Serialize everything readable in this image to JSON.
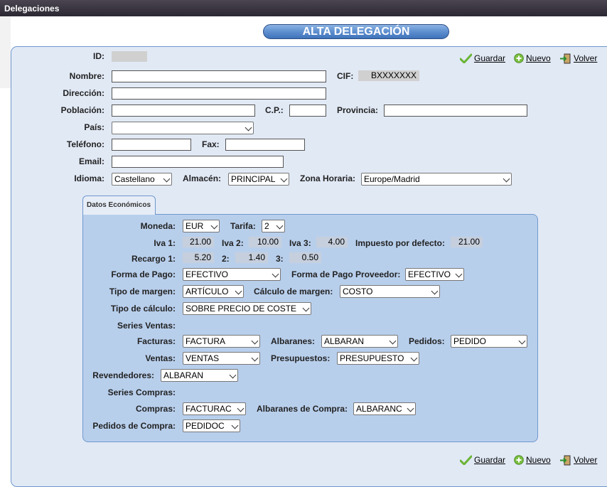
{
  "window": {
    "title": "Delegaciones"
  },
  "heading": "ALTA DELEGACIÓN",
  "actions": {
    "save": "Guardar",
    "new": "Nuevo",
    "back": "Volver"
  },
  "form": {
    "id": {
      "label": "ID:",
      "value": ""
    },
    "nombre": {
      "label": "Nombre:",
      "value": ""
    },
    "cif": {
      "label": "CIF:",
      "value": "BXXXXXXX"
    },
    "direccion": {
      "label": "Dirección:",
      "value": ""
    },
    "poblacion": {
      "label": "Población:",
      "value": ""
    },
    "cp": {
      "label": "C.P.:",
      "value": ""
    },
    "provincia": {
      "label": "Provincia:",
      "value": ""
    },
    "pais": {
      "label": "País:",
      "value": ""
    },
    "telefono": {
      "label": "Teléfono:",
      "value": ""
    },
    "fax": {
      "label": "Fax:",
      "value": ""
    },
    "email": {
      "label": "Email:",
      "value": ""
    },
    "idioma": {
      "label": "Idioma:",
      "value": "Castellano"
    },
    "almacen": {
      "label": "Almacén:",
      "value": "PRINCIPAL"
    },
    "zona": {
      "label": "Zona Horaria:",
      "value": "Europe/Madrid"
    }
  },
  "econ": {
    "tab": "Datos Económicos",
    "moneda": {
      "label": "Moneda:",
      "value": "EUR"
    },
    "tarifa": {
      "label": "Tarifa:",
      "value": "2"
    },
    "iva1": {
      "label": "Iva 1:",
      "value": "21.00"
    },
    "iva2": {
      "label": "Iva 2:",
      "value": "10.00"
    },
    "iva3": {
      "label": "Iva 3:",
      "value": "4.00"
    },
    "impuesto": {
      "label": "Impuesto por defecto:",
      "value": "21.00"
    },
    "recargo1": {
      "label": "Recargo 1:",
      "value": "5.20"
    },
    "recargo2": {
      "label": "2:",
      "value": "1.40"
    },
    "recargo3": {
      "label": "3:",
      "value": "0.50"
    },
    "formapago": {
      "label": "Forma de Pago:",
      "value": "EFECTIVO"
    },
    "formapagoprov": {
      "label": "Forma de Pago Proveedor:",
      "value": "EFECTIVO"
    },
    "tipomargen": {
      "label": "Tipo de margen:",
      "value": "ARTÍCULO"
    },
    "calculomargen": {
      "label": "Cálculo de margen:",
      "value": "COSTO"
    },
    "tipocalculo": {
      "label": "Tipo de cálculo:",
      "value": "SOBRE PRECIO DE COSTE"
    },
    "series_ventas": "Series Ventas:",
    "facturas": {
      "label": "Facturas:",
      "value": "FACTURA"
    },
    "albaranes": {
      "label": "Albaranes:",
      "value": "ALBARAN"
    },
    "pedidos": {
      "label": "Pedidos:",
      "value": "PEDIDO"
    },
    "ventas": {
      "label": "Ventas:",
      "value": "VENTAS"
    },
    "presupuestos": {
      "label": "Presupuestos:",
      "value": "PRESUPUESTO"
    },
    "revendedores": {
      "label": "Revendedores:",
      "value": "ALBARAN"
    },
    "series_compras": "Series Compras:",
    "compras": {
      "label": "Compras:",
      "value": "FACTURAC"
    },
    "albaranescompra": {
      "label": "Albaranes de Compra:",
      "value": "ALBARANC"
    },
    "pedidoscompra": {
      "label": "Pedidos de Compra:",
      "value": "PEDIDOC"
    }
  },
  "colors": {
    "titlebar": "#2c2833",
    "heading": "#3f73b9",
    "panel": "#e1e9f5",
    "econ_panel": "#b8cfec",
    "save_icon": "#6bb536",
    "new_icon": "#7cc042"
  }
}
